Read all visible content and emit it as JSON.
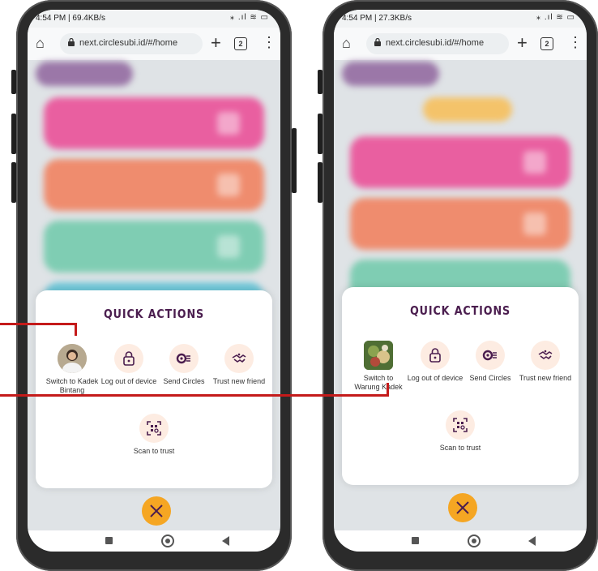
{
  "colors": {
    "title": "#4b1e4f",
    "accent_orange": "#f5a623",
    "icon_bg": "#fdece2",
    "callout_red": "#c41a1a",
    "card_pink": "#e95fa0",
    "card_orange": "#ef8c6e",
    "card_teal": "#7fcdb3"
  },
  "phones": [
    {
      "status": {
        "left": "4:54 PM | 69.4KB/s",
        "right": "⁎ .ıl ≋ ▭"
      },
      "browser": {
        "url": "next.circlesubi.id/#/home",
        "tab_count": "2"
      },
      "quick_actions": {
        "title": "QUICK ACTIONS",
        "switch_label": "Switch to Kadek Bintang",
        "logout_label": "Log out of device",
        "send_label": "Send Circles",
        "trust_label": "Trust new friend",
        "scan_label": "Scan to trust"
      },
      "icons": {
        "switch": "person-avatar-icon",
        "logout": "padlock-icon",
        "send": "send-circles-icon",
        "trust": "handshake-icon",
        "scan": "qr-scan-icon",
        "close": "close-icon"
      }
    },
    {
      "status": {
        "left": "4:54 PM | 27.3KB/s",
        "right": "⁎ .ıl ≋ ▭"
      },
      "browser": {
        "url": "next.circlesubi.id/#/home",
        "tab_count": "2"
      },
      "quick_actions": {
        "title": "QUICK ACTIONS",
        "switch_label": "Switch to Warung Kadek",
        "logout_label": "Log out of device",
        "send_label": "Send Circles",
        "trust_label": "Trust new friend",
        "scan_label": "Scan to trust"
      },
      "icons": {
        "switch": "shop-avatar-icon",
        "logout": "padlock-icon",
        "send": "send-circles-icon",
        "trust": "handshake-icon",
        "scan": "qr-scan-icon",
        "close": "close-icon"
      }
    }
  ]
}
